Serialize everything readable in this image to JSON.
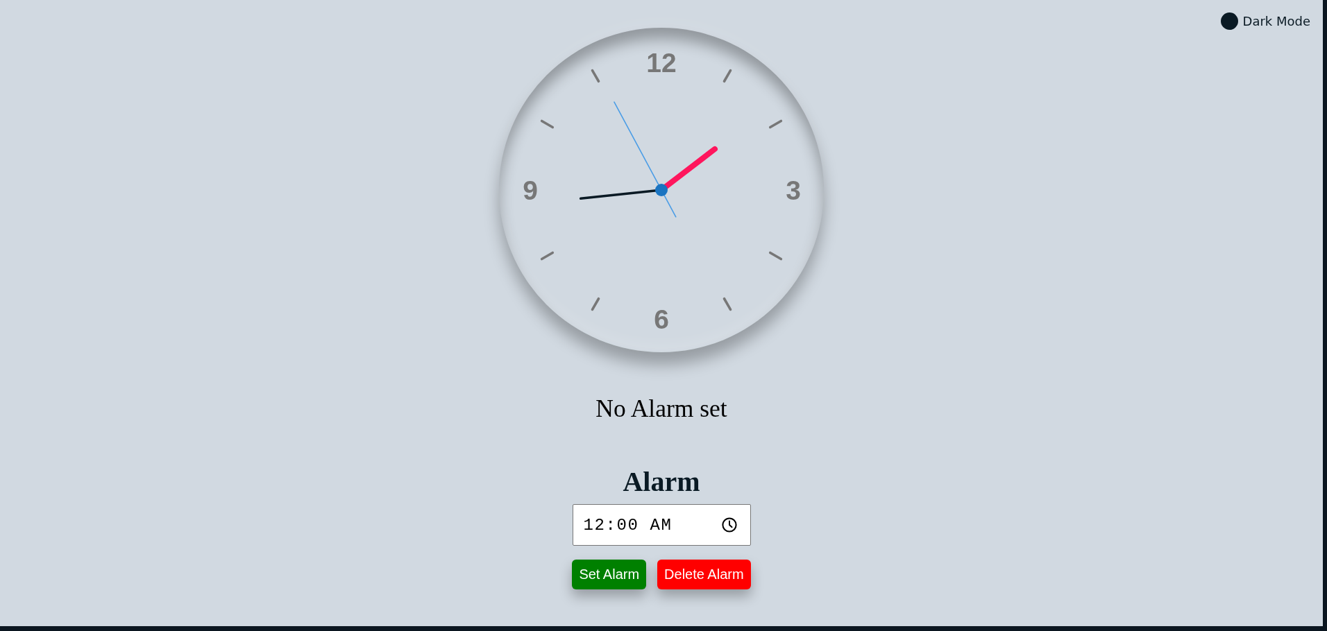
{
  "theme_toggle": {
    "label": "Dark Mode",
    "on": false
  },
  "clock": {
    "numbers": [
      "12",
      "3",
      "6",
      "9"
    ]
  },
  "alarm_status": "No Alarm set",
  "alarm": {
    "title": "Alarm",
    "time_input": {
      "value": "12:00 AM"
    },
    "buttons": [
      {
        "label": "Set Alarm",
        "kind": "set"
      },
      {
        "label": "Delete Alarm",
        "kind": "delete"
      }
    ]
  }
}
